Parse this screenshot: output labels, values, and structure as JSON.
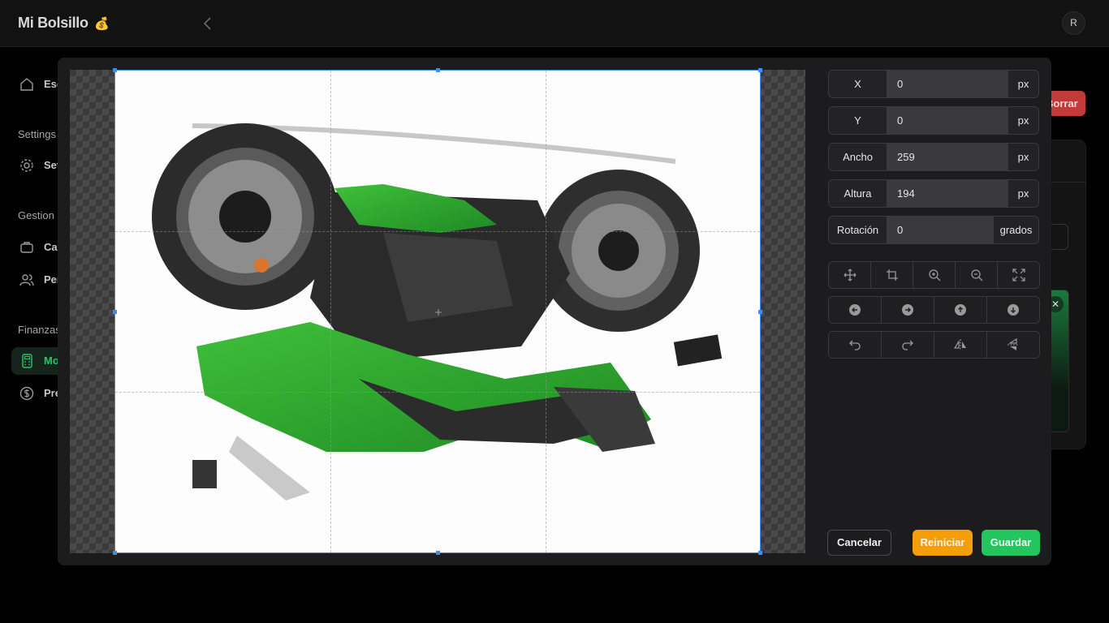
{
  "app": {
    "brand": "Mi Bolsillo",
    "brand_emoji": "💰",
    "avatar_initial": "R"
  },
  "sidebar": {
    "sections": [
      "Settings",
      "Gestion",
      "Finanzas"
    ],
    "items": [
      {
        "label": "Escritorio",
        "icon": "home-icon"
      },
      {
        "label": "Settings",
        "icon": "gear-icon"
      },
      {
        "label": "Categorias",
        "icon": "briefcase-icon"
      },
      {
        "label": "Personas",
        "icon": "users-icon"
      },
      {
        "label": "Movimientos",
        "icon": "calculator-icon",
        "active": true
      },
      {
        "label": "Presupuestos",
        "icon": "dollar-icon"
      }
    ]
  },
  "background": {
    "delete_label": "Borrar"
  },
  "editor": {
    "fields": [
      {
        "label": "X",
        "value": "0",
        "unit": "px"
      },
      {
        "label": "Y",
        "value": "0",
        "unit": "px"
      },
      {
        "label": "Ancho",
        "value": "259",
        "unit": "px"
      },
      {
        "label": "Altura",
        "value": "194",
        "unit": "px"
      },
      {
        "label": "Rotación",
        "value": "0",
        "unit": "grados"
      }
    ],
    "toolbar_rows": [
      [
        "move-icon",
        "crop-icon",
        "zoom-in-icon",
        "zoom-out-icon",
        "fullscreen-icon"
      ],
      [
        "arrow-left-icon",
        "arrow-right-icon",
        "arrow-up-icon",
        "arrow-down-icon"
      ],
      [
        "rotate-left-icon",
        "rotate-right-icon",
        "flip-horizontal-icon",
        "flip-vertical-icon"
      ]
    ],
    "actions": {
      "cancel": "Cancelar",
      "reset": "Reiniciar",
      "save": "Guardar"
    }
  },
  "colors": {
    "accent_green": "#22c55e",
    "accent_orange": "#f59e0b",
    "crop_blue": "#3b8ff0",
    "danger": "#c23b3b"
  }
}
